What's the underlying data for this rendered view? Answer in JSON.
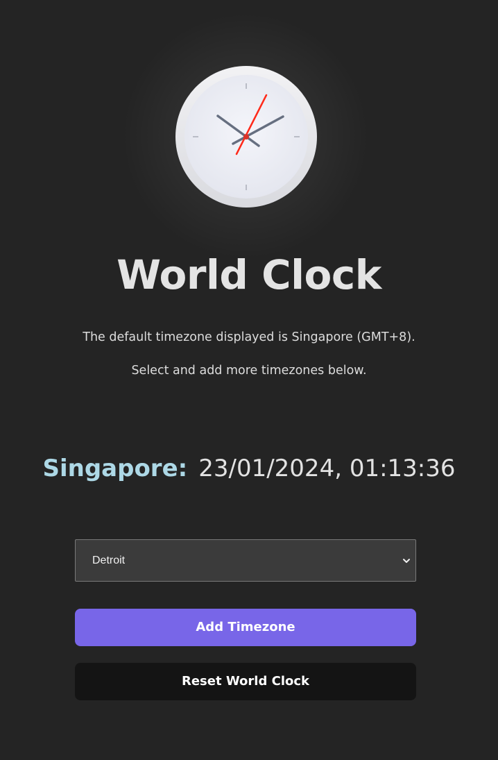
{
  "header": {
    "title": "World Clock",
    "intro_line_1": "The default timezone displayed is Singapore (GMT+8).",
    "intro_line_2": "Select and add more timezones below."
  },
  "clock_icon": {
    "icon": "analog-clock-icon",
    "face_color": "#eef0f6",
    "rim_color": "#e6e7eb",
    "hand_color": "#666f80",
    "second_hand_color": "#ff2a1a"
  },
  "timezones": [
    {
      "name": "Singapore:",
      "datetime": "23/01/2024, 01:13:36"
    }
  ],
  "controls": {
    "timezone_select": {
      "selected": "Detroit",
      "chevron_icon": "chevron-down-icon"
    },
    "add_button_label": "Add Timezone",
    "reset_button_label": "Reset World Clock"
  },
  "colors": {
    "background": "#242424",
    "zone_name": "#add8e6",
    "primary_button": "#7866e8",
    "secondary_button": "#141414"
  }
}
